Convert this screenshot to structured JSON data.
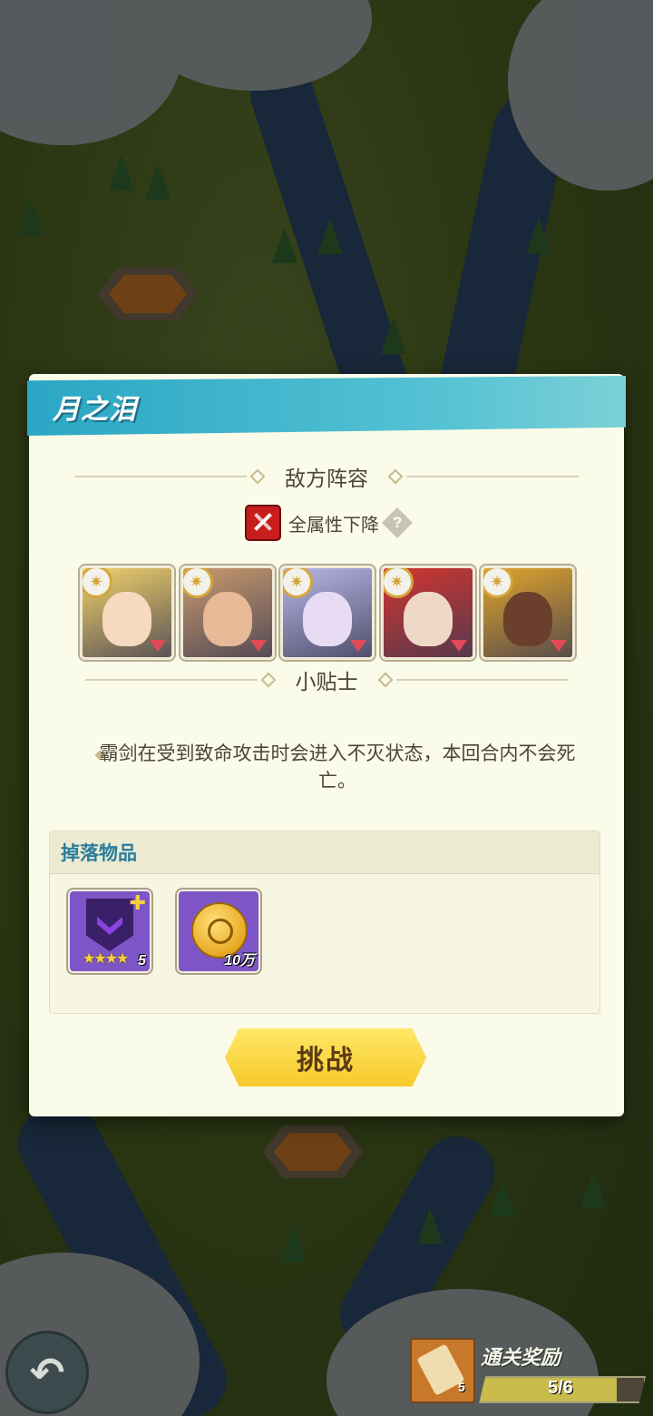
{
  "stage": {
    "title": "月之泪"
  },
  "enemy": {
    "heading": "敌方阵容",
    "debuff_label": "全属性下降",
    "help_symbol": "?",
    "heroes": [
      {
        "name": "hero-1",
        "tone": "#f1d26a",
        "face": "#f7d9bf"
      },
      {
        "name": "hero-2",
        "tone": "#c99a6d",
        "face": "#e8b996"
      },
      {
        "name": "hero-3",
        "tone": "#b7b7e8",
        "face": "#e7dcf4"
      },
      {
        "name": "hero-4",
        "tone": "#d2352f",
        "face": "#f0d8c8"
      },
      {
        "name": "hero-5",
        "tone": "#e0a52b",
        "face": "#6a3f2c"
      }
    ]
  },
  "tips": {
    "heading": "小贴士",
    "text": "霸剑在受到致命攻击时会进入不灭状态，本回合内不会死亡。"
  },
  "drops": {
    "heading": "掉落物品",
    "items": [
      {
        "icon": "purple-shield-icon",
        "stars": "★★★★",
        "count": "5"
      },
      {
        "icon": "gold-coin-icon",
        "count": "10万"
      }
    ]
  },
  "actions": {
    "challenge": "挑战",
    "back_symbol": "↶"
  },
  "reward": {
    "label": "通关奖励",
    "badge": "5",
    "progress_text": "5/6",
    "progress_fraction": 0.8333
  }
}
